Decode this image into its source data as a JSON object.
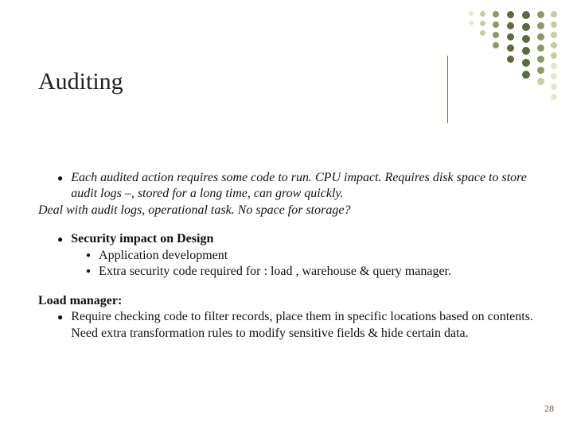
{
  "title": "Auditing",
  "block1": {
    "bullet_text": "Each audited action requires some code to run. CPU impact. Requires disk space to store audit logs –, stored for a long time, can grow quickly.",
    "after": "Deal with audit logs, operational task. No space for storage?"
  },
  "block2": {
    "heading": "Security impact on Design",
    "items": [
      "Application  development",
      "Extra security code required for : load , warehouse & query manager."
    ]
  },
  "block3": {
    "heading": "Load manager:",
    "text": "Require checking code to filter records, place them in specific locations based on contents. Need extra transformation rules to modify sensitive fields & hide certain data."
  },
  "page_number": "28",
  "dot_colors": {
    "dark": "#5a6b3e",
    "med": "#8a9a66",
    "light": "#c3cf9d",
    "pale": "#e3e9c8"
  }
}
